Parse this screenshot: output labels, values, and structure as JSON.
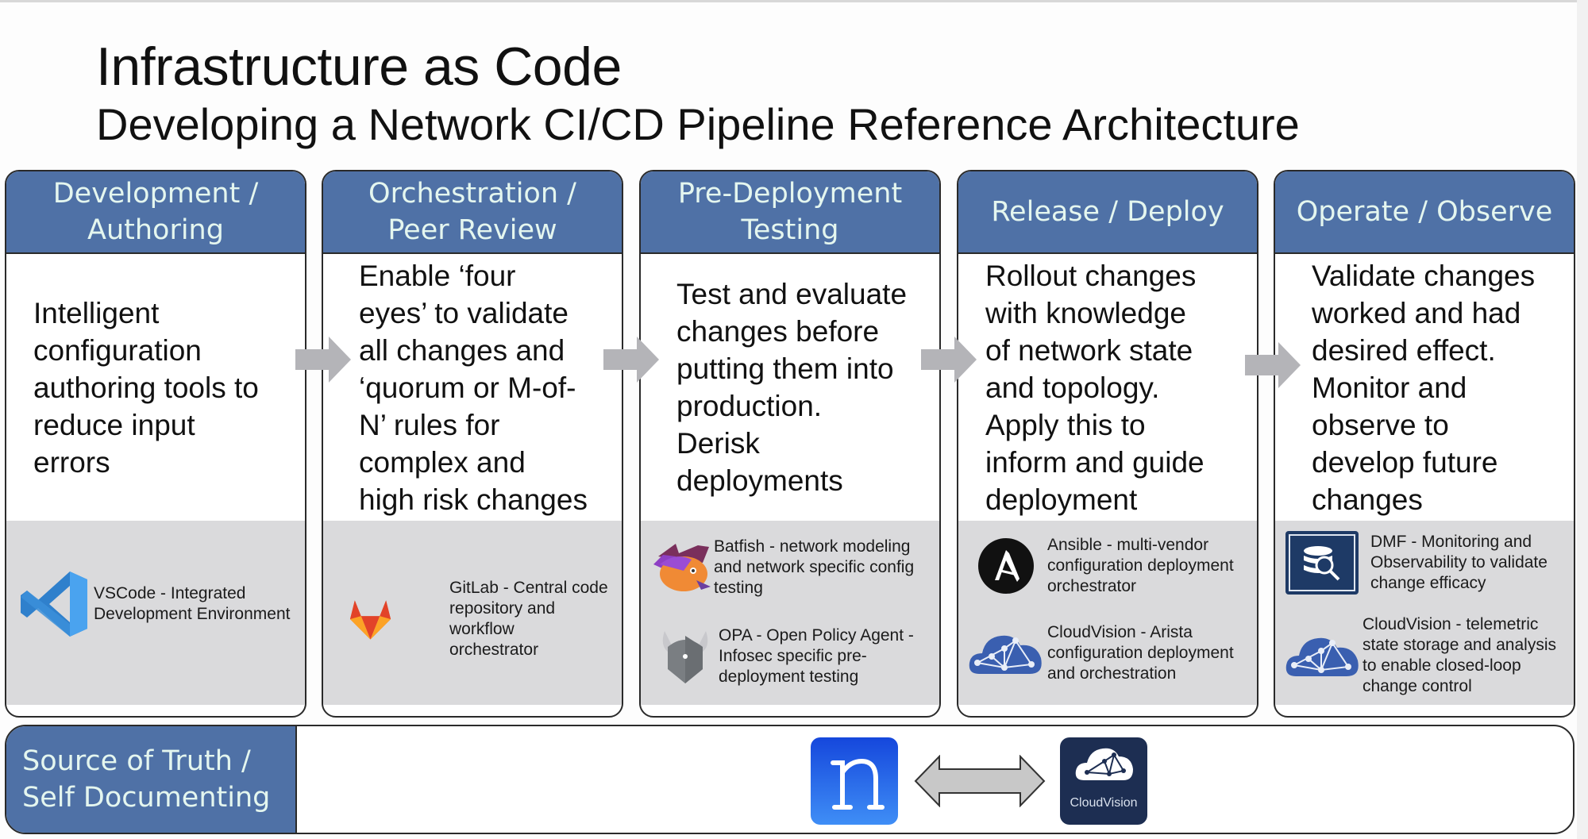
{
  "header": {
    "title": "Infrastructure as Code",
    "subtitle": "Developing a Network CI/CD Pipeline Reference Architecture"
  },
  "colors": {
    "header_blue": "#4f71a6",
    "header_text": "#e4f6ef",
    "tools_band": "#dadadc",
    "arrow_gray": "#b4b4b8"
  },
  "stages": [
    {
      "title": "Development /\nAuthoring",
      "description": "Intelligent\nconfiguration\nauthoring tools to\nreduce input\nerrors",
      "tools": [
        {
          "icon": "vscode-icon",
          "text": "VSCode - Integrated\nDevelopment Environment"
        }
      ]
    },
    {
      "title": "Orchestration /\nPeer Review",
      "description": "Enable ‘four\neyes’ to validate\nall changes and\n‘quorum or M-of-\nN’ rules for\ncomplex and\nhigh risk changes",
      "tools": [
        {
          "icon": "gitlab-icon",
          "text": "GitLab - Central code\nrepository and workflow\norchestrator"
        }
      ]
    },
    {
      "title": "Pre-Deployment\nTesting",
      "description": "Test and evaluate\nchanges before\nputting them into\nproduction.\nDerisk\ndeployments",
      "tools": [
        {
          "icon": "batfish-icon",
          "text": "Batfish - network modeling\nand network specific config\ntesting"
        },
        {
          "icon": "opa-icon",
          "text": "OPA - Open Policy Agent -\nInfosec specific pre-\ndeployment testing"
        }
      ]
    },
    {
      "title": "Release / Deploy",
      "description": "Rollout changes\nwith knowledge\nof network state\nand topology.\nApply this to\ninform and guide\ndeployment",
      "tools": [
        {
          "icon": "ansible-icon",
          "text": "Ansible - multi-vendor\nconfiguration deployment\norchestrator"
        },
        {
          "icon": "cloudvision-icon",
          "text": "CloudVision - Arista\nconfiguration deployment\nand orchestration"
        }
      ]
    },
    {
      "title": "Operate / Observe",
      "description": "Validate changes\nworked and had\ndesired effect.\nMonitor and\nobserve to\ndevelop future\nchanges",
      "tools": [
        {
          "icon": "dmf-icon",
          "text": "DMF - Monitoring and\nObservability to validate\nchange efficacy"
        },
        {
          "icon": "cloudvision-icon",
          "text": "CloudVision - telemetric\nstate storage and analysis\nto enable closed-loop\nchange control"
        }
      ]
    }
  ],
  "source_of_truth": {
    "title": "Source of Truth /\nSelf Documenting",
    "left_logo": "netbox-icon",
    "right_logo": "cloudvision-icon",
    "right_logo_label": "CloudVision"
  }
}
